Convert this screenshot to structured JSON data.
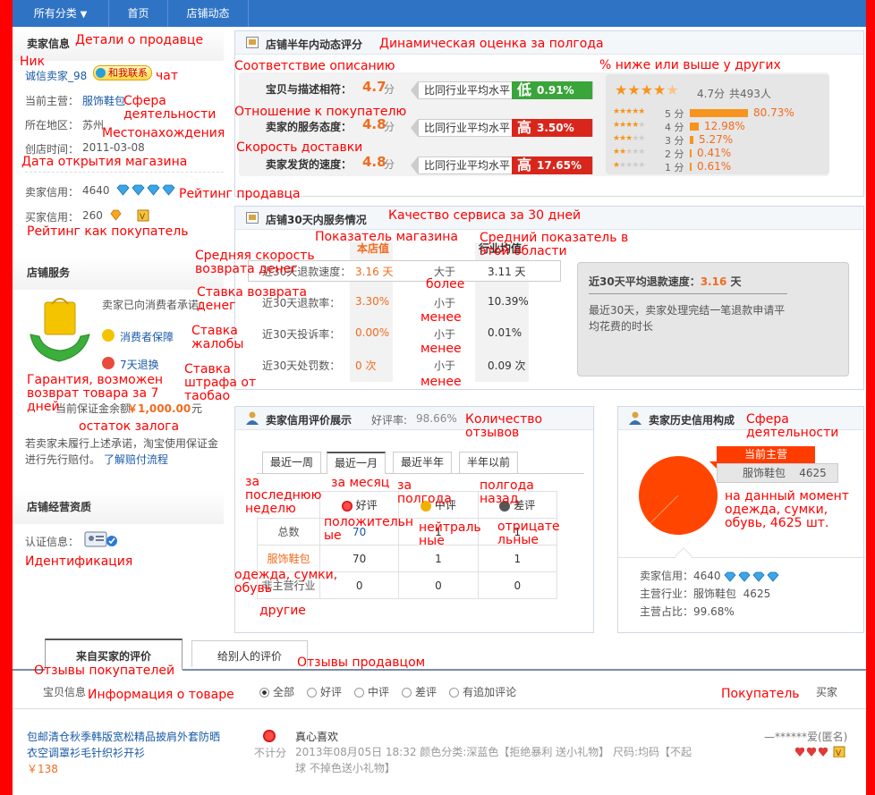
{
  "nav": {
    "all_categories": "所有分类",
    "home": "首页",
    "store_news": "店铺动态"
  },
  "seller": {
    "section_title": "卖家信息",
    "nick": "诚信卖家_98",
    "chat_label": "和我联系",
    "main_business_label": "当前主营：",
    "main_business": "服饰鞋包",
    "region_label": "所在地区：",
    "region": "苏州",
    "created_label": "创店时间：",
    "created": "2011-03-08",
    "seller_credit_label": "卖家信用：",
    "seller_credit": "4640",
    "buyer_credit_label": "买家信用：",
    "buyer_credit": "260"
  },
  "store_service": {
    "section_title": "店铺服务",
    "commitment": "卖家已向消费者承诺：",
    "guarantee": "消费者保障",
    "return7": "7天退换",
    "deposit_prefix": "当前保证金余额",
    "deposit_amount": "￥1,000.00",
    "deposit_unit": "元",
    "notice": "若卖家未履行上述承诺，淘宝使用保证金进行先行赔付。",
    "notice_link": "了解赔付流程"
  },
  "qualification": {
    "section_title": "店铺经营资质",
    "cert_label": "认证信息："
  },
  "dsr": {
    "title": "店铺半年内动态评分",
    "rows": [
      {
        "label": "宝贝与描述相符：",
        "score": "4.7",
        "unit": "分",
        "compare": "比同行业平均水平",
        "symbol": "低",
        "pct": "0.91%",
        "color": "#3aa53a"
      },
      {
        "label": "卖家的服务态度：",
        "score": "4.8",
        "unit": "分",
        "compare": "比同行业平均水平",
        "symbol": "高",
        "pct": "3.50%",
        "color": "#d9261c"
      },
      {
        "label": "卖家发货的速度：",
        "score": "4.8",
        "unit": "分",
        "compare": "比同行业平均水平",
        "symbol": "高",
        "pct": "17.65%",
        "color": "#d9261c"
      }
    ],
    "summary_score": "4.7分",
    "summary_total": "共493人",
    "dist": [
      {
        "label": "5 分",
        "pct": "80.73%",
        "value": 80.73
      },
      {
        "label": "4 分",
        "pct": "12.98%",
        "value": 12.98
      },
      {
        "label": "3 分",
        "pct": "5.27%",
        "value": 5.27
      },
      {
        "label": "2 分",
        "pct": "0.41%",
        "value": 0.41
      },
      {
        "label": "1 分",
        "pct": "0.61%",
        "value": 0.61
      }
    ]
  },
  "service30": {
    "title": "店铺30天内服务情况",
    "col_store": "本店值",
    "col_industry": "行业均值",
    "rows": [
      {
        "label": "近30天退款速度：",
        "store": "3.16 天",
        "cmp": "大于",
        "industry": "3.11 天"
      },
      {
        "label": "近30天退款率：",
        "store": "3.30%",
        "cmp": "小于",
        "industry": "10.39%"
      },
      {
        "label": "近30天投诉率：",
        "store": "0.00%",
        "cmp": "小于",
        "industry": "0.01%"
      },
      {
        "label": "近30天处罚数：",
        "store": "0 次",
        "cmp": "小于",
        "industry": "0.09 次"
      }
    ],
    "box_title": "近30天平均退款速度：",
    "box_value": "3.16",
    "box_unit": "天",
    "box_desc": "最近30天，卖家处理完结一笔退款申请平均花费的时长"
  },
  "credit": {
    "title": "卖家信用评价展示",
    "rate_label": "好评率:",
    "rate": "98.66%",
    "tabs": [
      "最近一周",
      "最近一月",
      "最近半年",
      "半年以前"
    ],
    "cols": [
      "好评",
      "中评",
      "差评"
    ],
    "rows": [
      {
        "label": "总数",
        "vals": [
          "70",
          "1",
          "1"
        ]
      },
      {
        "label": "服饰鞋包",
        "vals": [
          "70",
          "1",
          "1"
        ]
      },
      {
        "label": "非主营行业",
        "vals": [
          "0",
          "0",
          "0"
        ]
      }
    ]
  },
  "history": {
    "title": "卖家历史信用构成",
    "current_label": "当前主营",
    "category": "服饰鞋包",
    "count": "4625",
    "seller_credit_label": "卖家信用：",
    "seller_credit": "4640",
    "main_label": "主营行业：",
    "main": "服饰鞋包",
    "main_count": "4625",
    "share_label": "主营占比：",
    "share": "99.68%",
    "share_value": 99.68
  },
  "reviews": {
    "tab_from_buyers": "来自买家的评价",
    "tab_to_others": "给别人的评价",
    "col_item": "宝贝信息",
    "filters": [
      "全部",
      "好评",
      "中评",
      "差评",
      "有追加评论"
    ],
    "col_buyer": "买家",
    "item_title": "包邮清仓秋季韩版宽松精品披肩外套防晒衣空调罩衫毛针织衫开衫",
    "item_price": "￥138",
    "not_counted": "不计分",
    "comment": "真心喜欢",
    "detail": "2013年08月05日 18:32 颜色分类:深蓝色【拒绝暴利 送小礼物】 尺码:均码【不起球 不掉色送小礼物】",
    "buyer": "—******爱(匿名)"
  },
  "annotations": {
    "a1": "Детали о продавце",
    "a2": "Ник",
    "a3": "чат",
    "a4": "Сфера\nдеятельности",
    "a5": "Местонахождения",
    "a6": "Дата открытия магазина",
    "a7": "Рейтинг продавца",
    "a8": "Рейтинг как покупатель",
    "a9": "Гарантия, возможен\nвозврат товара за 7\nдней",
    "a10": "остаток залога",
    "a11": "Идентификация",
    "a12": "Динамическая оценка за полгода",
    "a13": "Соответствие описанию",
    "a14": "% ниже или выше у других",
    "a15": "Отношение к покупателю",
    "a16": "Скорость доставки",
    "a17": "Качество сервиса за 30 дней",
    "a18": "Показатель магазина",
    "a19": "Средний показатель в\nэтой области",
    "a20": "Средняя скорость\nвозврата денег",
    "a21": "Ставка возврата\nденег",
    "a22": "Ставка\nжалобы",
    "a23": "Ставка\nштрафа от\nтаобао",
    "a24": "более",
    "a25": "менее",
    "a26": "менее",
    "a27": "менее",
    "a28": "Количество\nотзывов",
    "a29": "Сфера\nдеятельности",
    "a30": "за\nпоследнюю\nнеделю",
    "a31": "за месяц",
    "a32": "за\nполгода",
    "a33": "полгода\nназад",
    "a34": "положительн\nые",
    "a35": "нейтраль\nные",
    "a36": "отрицате\nльные",
    "a37": "одежда, сумки,\nобувь",
    "a38": "другие",
    "a39": "на данный момент\nодежда, сумки,\nобувь, 4625 шт.",
    "a40": "Отзывы покупателей",
    "a41": "Отзывы продавцом",
    "a42": "Информация о товаре",
    "a43": "Покупатель"
  }
}
